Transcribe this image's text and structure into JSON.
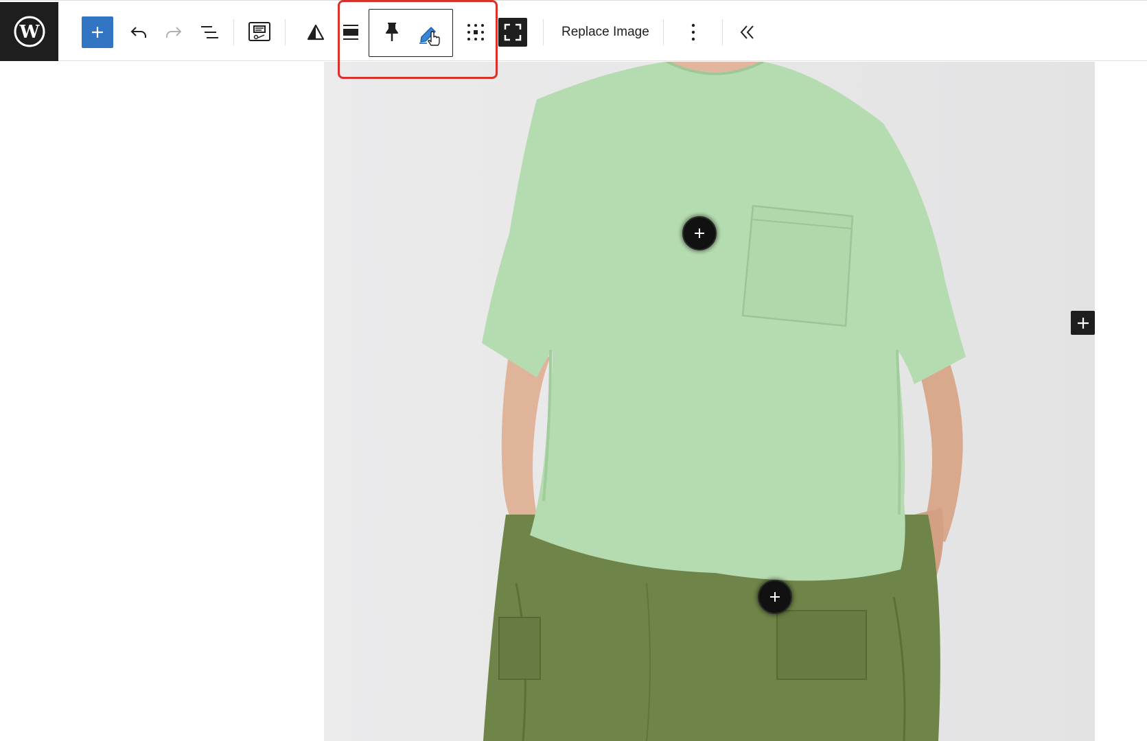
{
  "toolbar": {
    "logo_icon": "wordpress-logo-icon",
    "inserter_icon": "plus-icon",
    "undo_icon": "undo-icon",
    "redo_icon": "redo-icon",
    "list_view_icon": "list-view-icon",
    "block_type_icon": "image-block-icon",
    "warning_icon": "triangle-icon",
    "align_icon": "align-full-icon",
    "pin_icon": "pin-icon",
    "edit_icon": "pencil-icon",
    "drag_icon": "drag-handle-icon",
    "fullscreen_icon": "fullscreen-icon",
    "replace_label": "Replace Image",
    "more_icon": "more-vertical-icon",
    "collapse_icon": "chevrons-left-icon"
  },
  "canvas": {
    "hotspots": [
      {
        "icon": "plus-icon"
      },
      {
        "icon": "plus-icon"
      }
    ],
    "side_inserter_icon": "plus-icon"
  },
  "colors": {
    "accent": "#3174c1",
    "highlight": "#d9302c",
    "dark": "#1e1e1e",
    "shirt": "#b5dcb0",
    "shorts": "#6f8448"
  }
}
